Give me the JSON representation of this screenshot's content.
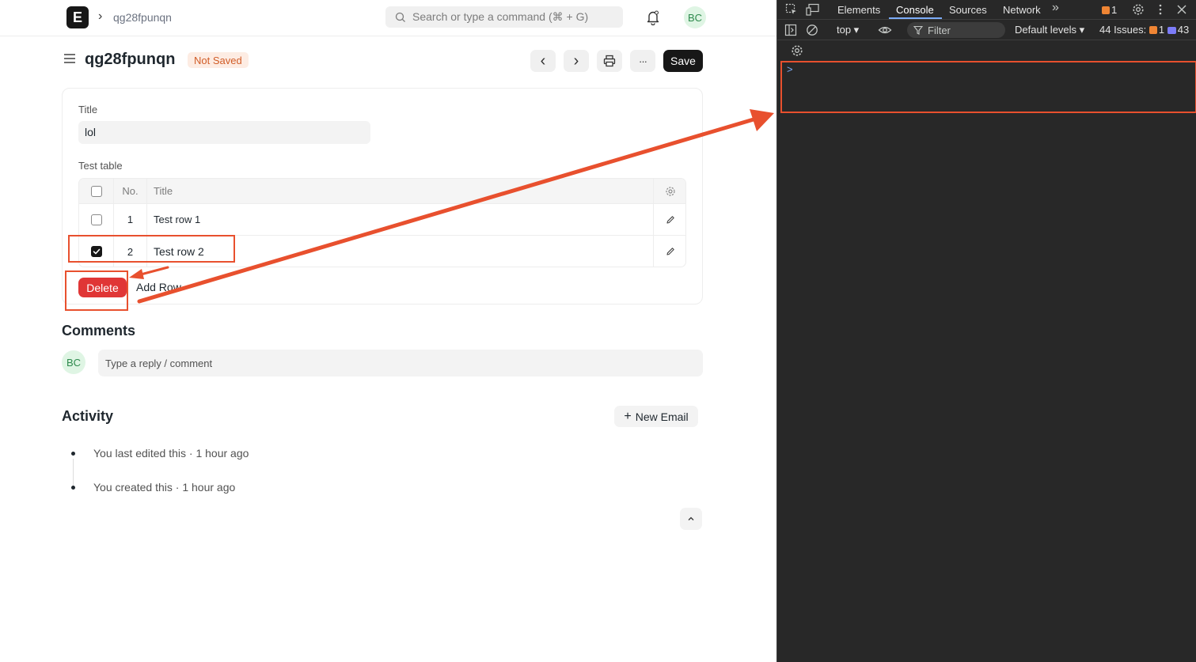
{
  "navbar": {
    "logo_letter": "E",
    "breadcrumb_sep": "›",
    "breadcrumb": "qg28fpunqn",
    "search_placeholder": "Search or type a command (⌘ + G)",
    "user_initials": "BC"
  },
  "page": {
    "title": "qg28fpunqn",
    "status": "Not Saved",
    "prev_icon": "‹",
    "next_icon": "›",
    "more_icon": "···",
    "save_label": "Save"
  },
  "form": {
    "title_label": "Title",
    "title_value": "lol",
    "table_label": "Test table",
    "columns": {
      "no": "No.",
      "title": "Title"
    },
    "rows": [
      {
        "no": "1",
        "title": "Test row 1",
        "checked": false
      },
      {
        "no": "2",
        "title": "Test row 2",
        "checked": true
      }
    ],
    "delete_label": "Delete",
    "add_row_label": "Add Row"
  },
  "comments": {
    "heading": "Comments",
    "avatar_initials": "BC",
    "placeholder": "Type a reply / comment"
  },
  "activity": {
    "heading": "Activity",
    "new_email_label": "New Email",
    "new_email_icon": "+",
    "items": [
      "You last edited this · 1 hour ago",
      "You created this · 1 hour ago"
    ]
  },
  "devtools": {
    "tabs": [
      "Elements",
      "Console",
      "Sources",
      "Network"
    ],
    "active_tab": "Console",
    "overflow_icon": "»",
    "warning_count": "1",
    "context": "top ▾",
    "filter_placeholder": "Filter",
    "levels": "Default levels ▾",
    "issues_label": "44 Issues:",
    "issues_warn": "1",
    "issues_info": "43",
    "prompt": ">"
  },
  "colors": {
    "primary_button": "#171717",
    "danger": "#e03636",
    "annotation": "#e8502e",
    "status_pill": "#d15d28",
    "devtools_bg": "#282828",
    "devtools_accent": "#7cacf8"
  }
}
